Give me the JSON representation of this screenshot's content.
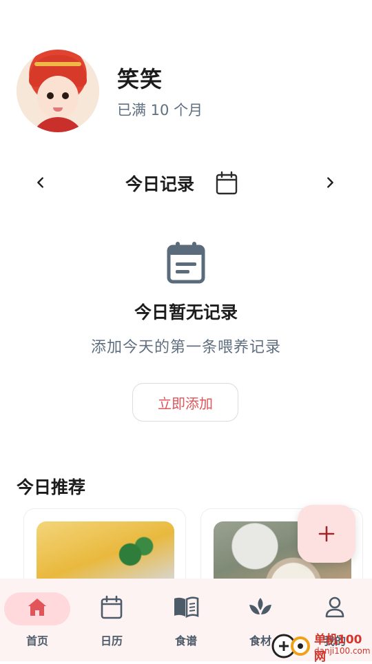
{
  "profile": {
    "name": "笑笑",
    "age": "已满 10 个月"
  },
  "day_nav": {
    "title": "今日记录",
    "prev_icon": "chevron-left-icon",
    "next_icon": "chevron-right-icon",
    "calendar_icon": "calendar-icon"
  },
  "empty_state": {
    "icon": "clipboard-icon",
    "title": "今日暂无记录",
    "subtitle": "添加今天的第一条喂养记录",
    "button": "立即添加"
  },
  "recommendations": {
    "title": "今日推荐"
  },
  "fab": {
    "icon": "plus-icon"
  },
  "tabs": [
    {
      "label": "首页",
      "icon": "home-icon",
      "active": true
    },
    {
      "label": "日历",
      "icon": "calendar-icon"
    },
    {
      "label": "食谱",
      "icon": "book-icon"
    },
    {
      "label": "食材",
      "icon": "sprout-icon"
    },
    {
      "label": "我的",
      "icon": "person-icon"
    }
  ],
  "watermark": {
    "text": "单机100网",
    "url": "danji100.com"
  },
  "colors": {
    "accent": "#e0545a",
    "active_tab_bg": "#ffd9db",
    "tabbar_bg": "#fdf3f3",
    "muted_text": "#5f6f80"
  }
}
